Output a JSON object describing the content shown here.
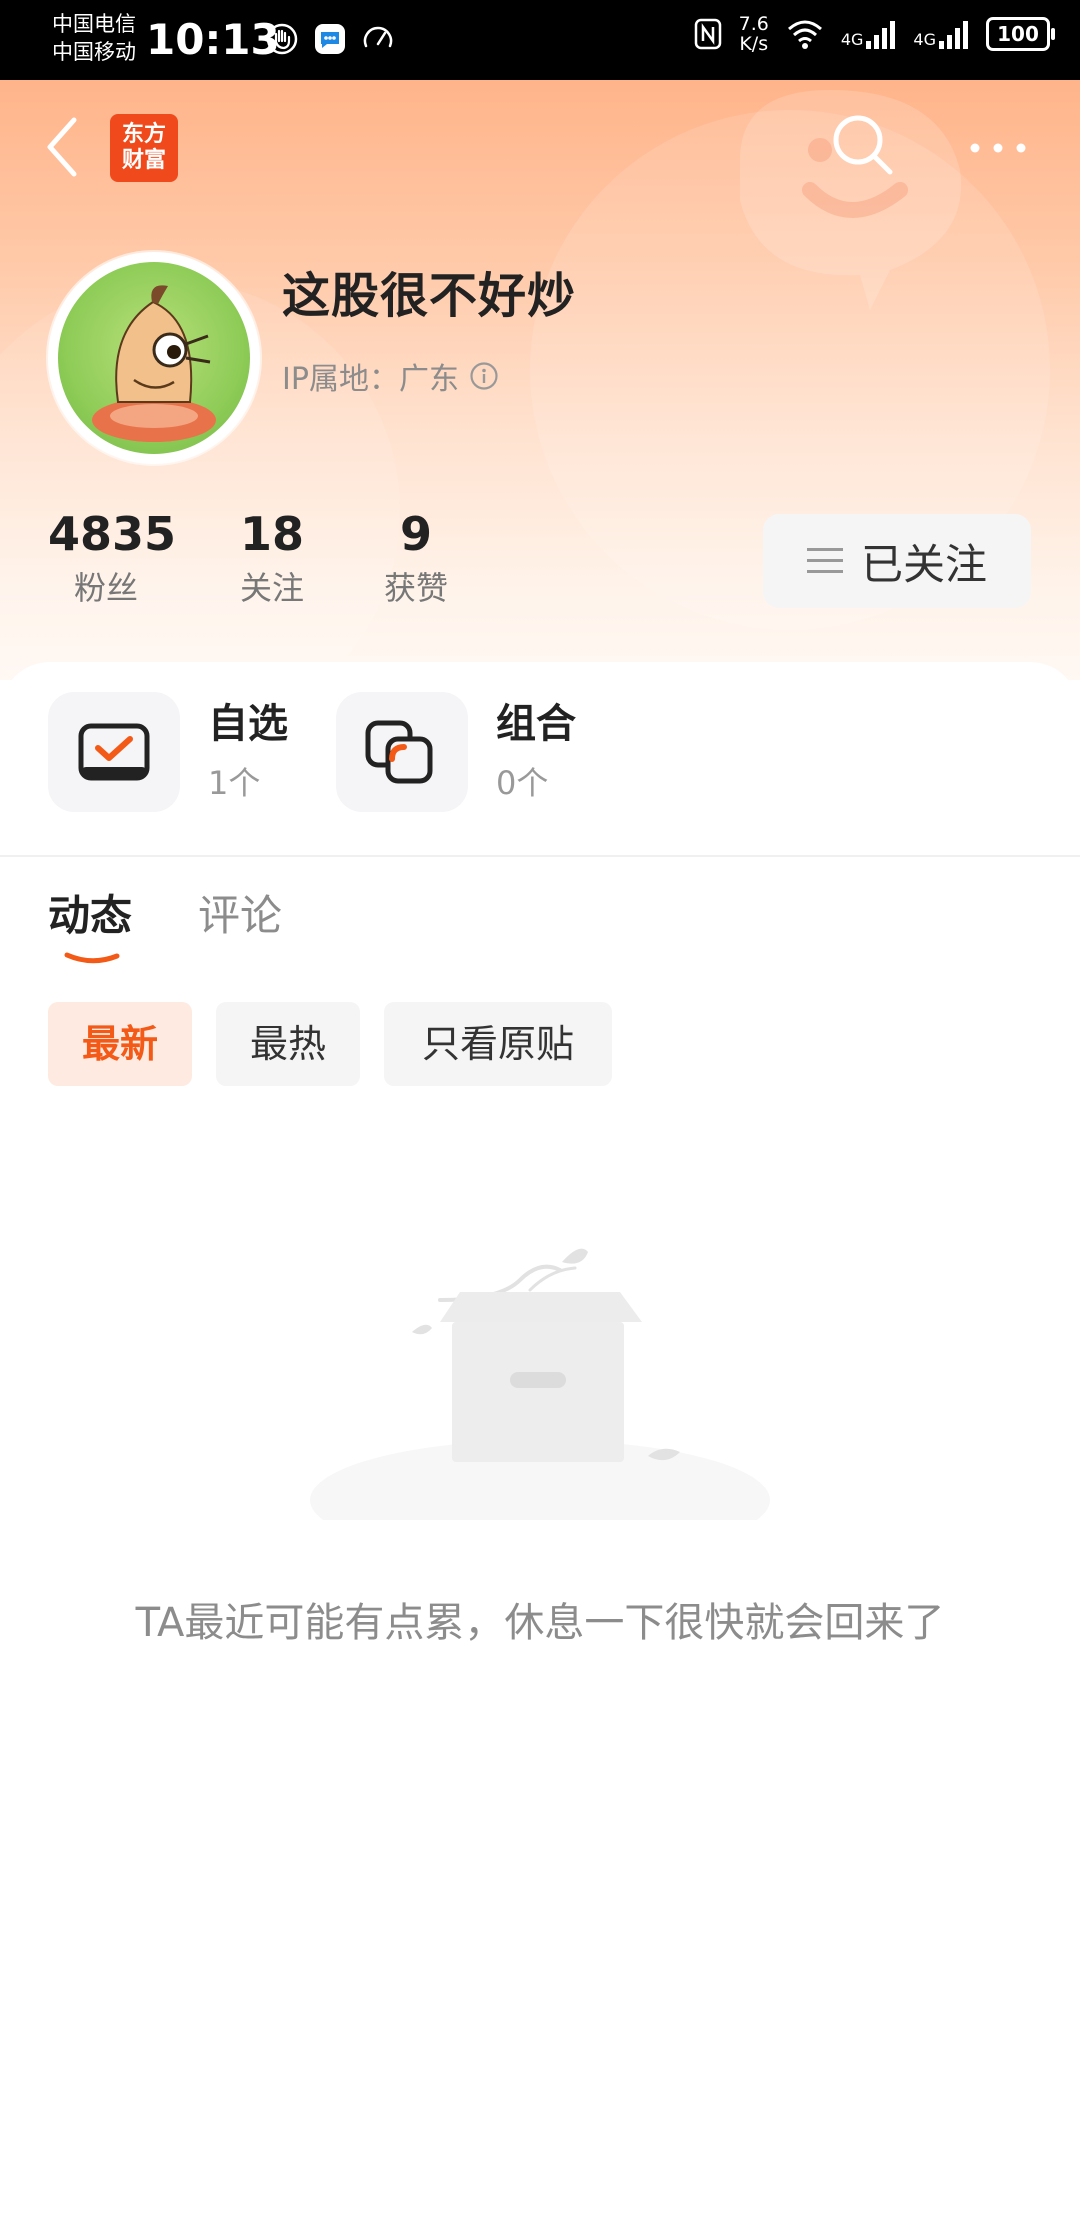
{
  "status_bar": {
    "carrier_1": "中国电信",
    "carrier_2": "中国移动",
    "time": "10:13",
    "net_speed_value": "7.6",
    "net_speed_unit": "K/s",
    "signal_1_label": "4G",
    "signal_2_label": "4G",
    "battery": "100"
  },
  "header": {
    "logo_line_1": "东方",
    "logo_line_2": "财富"
  },
  "profile": {
    "username": "这股很不好炒",
    "ip_location": "IP属地：广东",
    "stats": [
      {
        "value": "4835",
        "label": "粉丝"
      },
      {
        "value": "18",
        "label": "关注"
      },
      {
        "value": "9",
        "label": "获赞"
      }
    ],
    "follow_label": "已关注"
  },
  "shortcuts": [
    {
      "title": "自选",
      "count": "1个"
    },
    {
      "title": "组合",
      "count": "0个"
    }
  ],
  "tabs": [
    {
      "label": "动态",
      "active": true
    },
    {
      "label": "评论",
      "active": false
    }
  ],
  "filters": [
    {
      "label": "最新",
      "active": true
    },
    {
      "label": "最热",
      "active": false
    },
    {
      "label": "只看原贴",
      "active": false
    }
  ],
  "empty_state": {
    "message": "TA最近可能有点累，休息一下很快就会回来了"
  },
  "colors": {
    "accent": "#f35a17",
    "logo_bg": "#f04a1c",
    "hero_top": "#ffb48a"
  }
}
